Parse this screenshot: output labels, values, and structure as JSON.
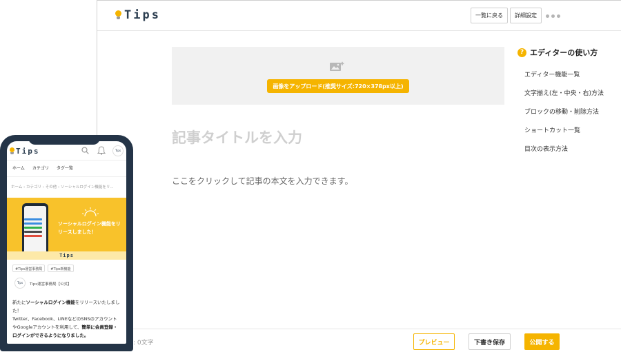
{
  "editor": {
    "brand": "Tips",
    "header": {
      "back_to_list": "一覧に戻る",
      "detail_settings": "詳細設定"
    },
    "upload": {
      "button_label": "画像をアップロード(推奨サイズ:720×378px以上)",
      "icon": "image-add-icon"
    },
    "title_placeholder": "記事タイトルを入力",
    "body_placeholder": "ここをクリックして記事の本文を入力できます。",
    "help": {
      "title": "エディターの使い方",
      "items": [
        "エディター機能一覧",
        "文字揃え(左・中央・右)方法",
        "ブロックの移動・削除方法",
        "ショートカット一覧",
        "目次の表示方法"
      ]
    },
    "footer": {
      "char_count": ": 0文字",
      "preview": "プレビュー",
      "save_draft": "下書き保存",
      "publish": "公開する"
    }
  },
  "mobile": {
    "brand": "Tips",
    "nav": [
      "ホーム",
      "カテゴリ",
      "タグ一覧"
    ],
    "breadcrumb": "ホーム › カテゴリ › その他 › ソーシャルログイン機能をリ...",
    "banner_text": "ソーシャルログイン機能をリリースしました！",
    "banner_brand": "Tips",
    "tags": [
      "#Tips運営事務局",
      "#Tips新機能"
    ],
    "author": "Tips運営事務局【公式】",
    "body": {
      "p1_pre": "新たに",
      "p1_bold": "ソーシャルログイン機能",
      "p1_post": "をリリースいたしました！",
      "p2_pre": "Twitter、Facebook、LINEなどのSNSのアカウントやGoogleアカウントを利用して、",
      "p2_bold": "簡単に会員登録・ログインができるようになりました。"
    }
  },
  "colors": {
    "accent": "#f5b400",
    "brand_text": "#2c3e50",
    "phone_frame": "#243447"
  }
}
